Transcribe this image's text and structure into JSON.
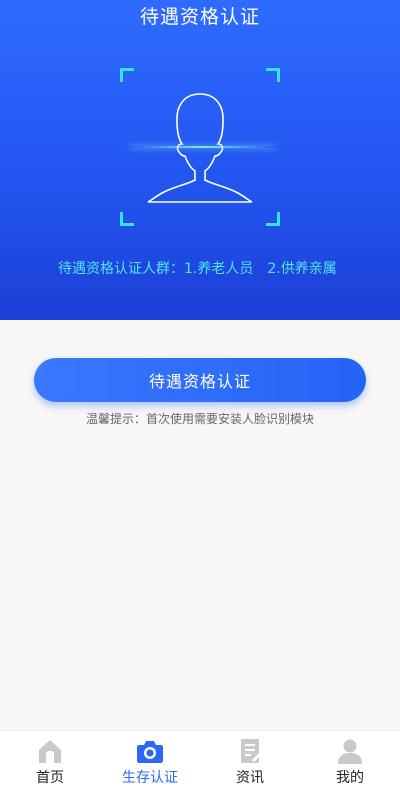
{
  "header": {
    "title": "待遇资格认证"
  },
  "hero": {
    "note": "待遇资格认证人群：1.养老人员　2.供养亲属"
  },
  "action": {
    "button_label": "待遇资格认证",
    "tip": "温馨提示：首次使用需要安装人脸识别模块"
  },
  "tabbar": {
    "items": [
      {
        "label": "首页",
        "icon": "home-icon",
        "active": false
      },
      {
        "label": "生存认证",
        "icon": "camera-icon",
        "active": true
      },
      {
        "label": "资讯",
        "icon": "document-icon",
        "active": false
      },
      {
        "label": "我的",
        "icon": "person-icon",
        "active": false
      }
    ]
  },
  "colors": {
    "primary": "#2c68f5",
    "accent_cyan": "#35e3f3",
    "inactive_icon": "#c9c9c9"
  }
}
